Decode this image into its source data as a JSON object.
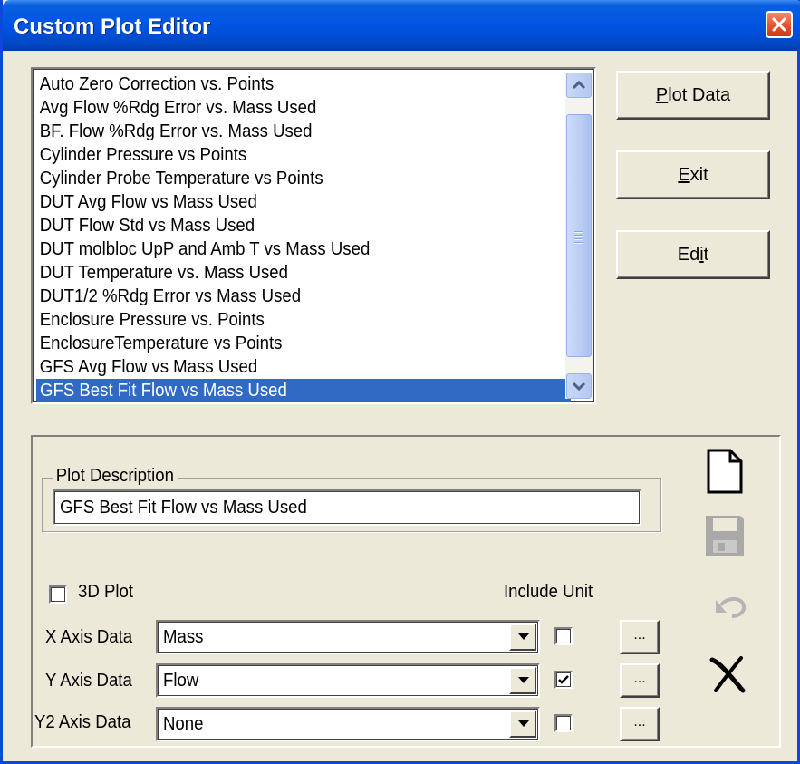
{
  "window": {
    "title": "Custom Plot Editor"
  },
  "plot_list": {
    "items": [
      "Auto Zero Correction vs. Points",
      "Avg Flow %Rdg Error vs. Mass Used",
      "BF. Flow %Rdg Error vs. Mass Used",
      "Cylinder Pressure vs Points",
      "Cylinder Probe Temperature vs Points",
      "DUT Avg Flow vs Mass Used",
      "DUT Flow Std vs Mass Used",
      "DUT molbloc UpP and Amb T vs Mass Used",
      "DUT Temperature vs. Mass Used",
      "DUT1/2 %Rdg Error vs Mass Used",
      "Enclosure Pressure vs. Points",
      "EnclosureTemperature vs Points",
      "GFS Avg Flow vs Mass Used",
      "GFS Best Fit Flow vs Mass Used"
    ],
    "selected_index": 13
  },
  "buttons": {
    "plot_data": {
      "pre": "",
      "key": "P",
      "post": "lot Data"
    },
    "exit": {
      "pre": "",
      "key": "E",
      "post": "xit"
    },
    "edit": {
      "pre": "Ed",
      "key": "i",
      "post": "t"
    }
  },
  "description": {
    "legend": "Plot Description",
    "value": "GFS Best Fit Flow vs Mass Used"
  },
  "plot_3d": {
    "label": "3D Plot",
    "checked": false
  },
  "include_unit_label": "Include Unit",
  "axes": [
    {
      "label": "X Axis Data",
      "value": "Mass",
      "include_unit": false,
      "browse": "..."
    },
    {
      "label": "Y Axis Data",
      "value": "Flow",
      "include_unit": true,
      "browse": "..."
    },
    {
      "label": "Y2 Axis Data",
      "value": "None",
      "include_unit": false,
      "browse": "..."
    }
  ],
  "toolbar_icons": [
    "new-document-icon",
    "save-icon",
    "undo-icon",
    "delete-icon"
  ],
  "colors": {
    "selection": "#316ac5",
    "titlebar": "#0054e3",
    "close": "#e0502c"
  }
}
